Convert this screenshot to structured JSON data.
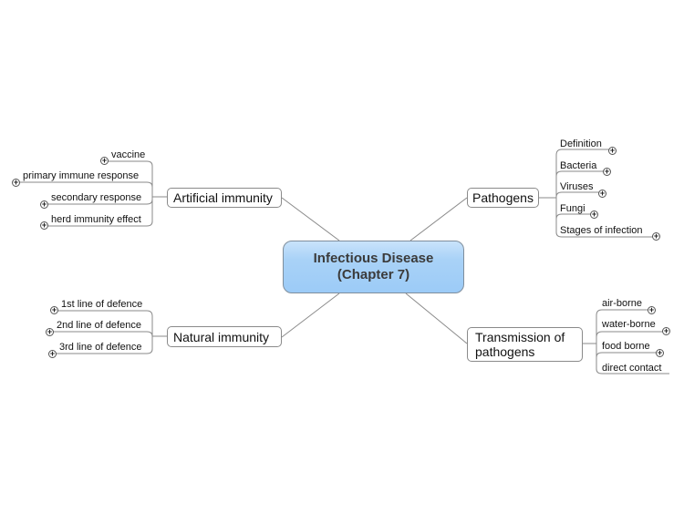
{
  "map": {
    "central": {
      "line1": "Infectious Disease",
      "line2": "(Chapter 7)"
    },
    "branches": {
      "artificial": {
        "label": "Artificial immunity",
        "children": [
          "vaccine",
          "primary immune response",
          "secondary response",
          "herd immunity effect"
        ]
      },
      "pathogens": {
        "label": "Pathogens",
        "children": [
          "Definition",
          "Bacteria",
          "Viruses",
          "Fungi",
          "Stages of infection"
        ]
      },
      "natural": {
        "label": "Natural immunity",
        "children": [
          "1st line of defence",
          "2nd line of defence",
          "3rd line of defence"
        ]
      },
      "transmission": {
        "label_line1": "Transmission of",
        "label_line2": "pathogens",
        "children": [
          "air-borne",
          "water-borne",
          "food borne",
          "direct contact"
        ]
      }
    },
    "expand_symbol": "+"
  },
  "colors": {
    "central_fill": "#a9d2f7",
    "line": "#8a8a8a"
  }
}
